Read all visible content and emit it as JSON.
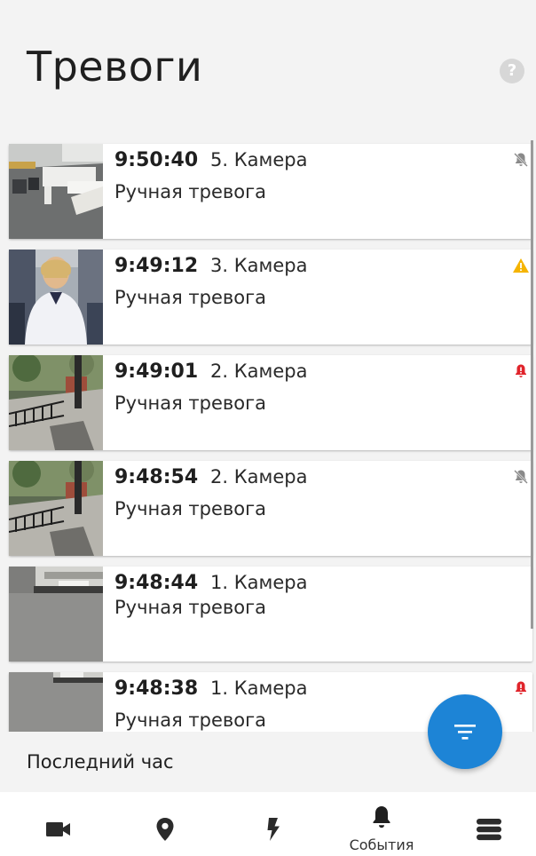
{
  "header": {
    "title": "Тревоги",
    "help_icon": "help-icon",
    "help_glyph": "?"
  },
  "events": [
    {
      "time": "9:50:40",
      "camera": "5. Камера",
      "type": "Ручная тревога",
      "status": "muted",
      "thumb": "office"
    },
    {
      "time": "9:49:12",
      "camera": "3. Камера",
      "type": "Ручная тревога",
      "status": "warning",
      "thumb": "person"
    },
    {
      "time": "9:49:01",
      "camera": "2. Камера",
      "type": "Ручная тревога",
      "status": "alarm",
      "thumb": "yard"
    },
    {
      "time": "9:48:54",
      "camera": "2. Камера",
      "type": "Ручная тревога",
      "status": "muted",
      "thumb": "yard"
    },
    {
      "time": "9:48:44",
      "camera": "1. Камера",
      "type": "Ручная тревога",
      "status": "none",
      "thumb": "car"
    },
    {
      "time": "9:48:38",
      "camera": "1. Камера",
      "type": "Ручная тревога",
      "status": "alarm",
      "thumb": "car2"
    }
  ],
  "filter": {
    "period_label": "Последний час"
  },
  "fab": {
    "icon": "filter-icon"
  },
  "nav": {
    "items": [
      {
        "icon": "camera-icon",
        "label": ""
      },
      {
        "icon": "map-pin-icon",
        "label": ""
      },
      {
        "icon": "lightning-icon",
        "label": ""
      },
      {
        "icon": "bell-icon",
        "label": "События",
        "active": true
      },
      {
        "icon": "menu-icon",
        "label": ""
      }
    ]
  },
  "colors": {
    "accent": "#1d84d6",
    "warning": "#f5b400",
    "alarm": "#e0242b",
    "muted": "#8a8a8a",
    "background": "#f3f3f3"
  }
}
